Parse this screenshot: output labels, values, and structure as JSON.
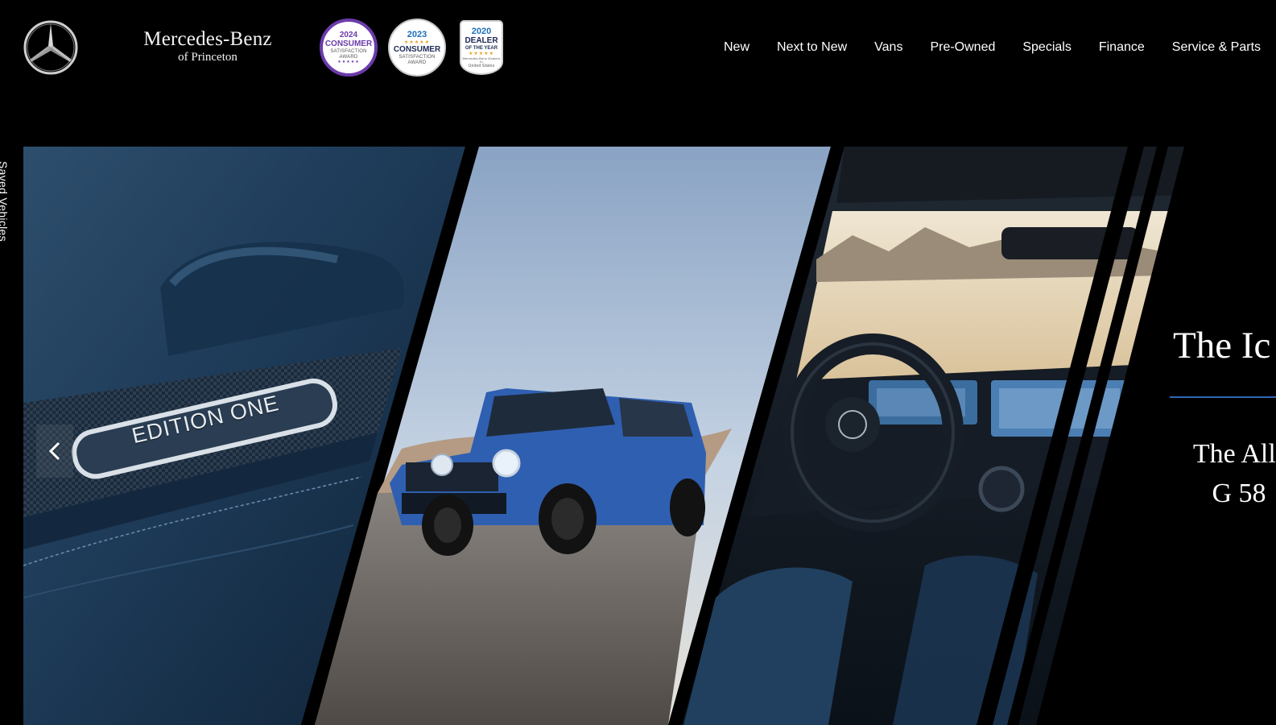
{
  "brand": {
    "name": "Mercedes-Benz",
    "location": "of Princeton"
  },
  "badges": [
    {
      "year": "2024",
      "title": "CONSUMER",
      "lines": [
        "SATISFACTION",
        "AWARD"
      ],
      "stars": "★★★★★",
      "accent": "#6c3bab"
    },
    {
      "year": "2023",
      "stars": "★★★★★",
      "title": "CONSUMER",
      "lines": [
        "SATISFACTION",
        "AWARD"
      ],
      "accent": "#1d6fb8"
    },
    {
      "year": "2020",
      "title": "DEALER",
      "subtitle": "OF THE YEAR",
      "stars": "★★★★★",
      "lines": [
        "Mercedes-Benz Dealers in",
        "United States"
      ],
      "accent": "#1d6fb8"
    }
  ],
  "nav": {
    "items": [
      "New",
      "Next to New",
      "Vans",
      "Pre-Owned",
      "Specials",
      "Finance",
      "Service & Parts"
    ]
  },
  "saved_tab": {
    "label": "Saved Vehicles"
  },
  "hero": {
    "badge_text": "EDITION ONE",
    "headline": "The Ic",
    "subline_1": "The All-",
    "subline_2": "G 58",
    "accent_color": "#2f67b8",
    "slider_prev_icon": "chevron-left-icon"
  }
}
